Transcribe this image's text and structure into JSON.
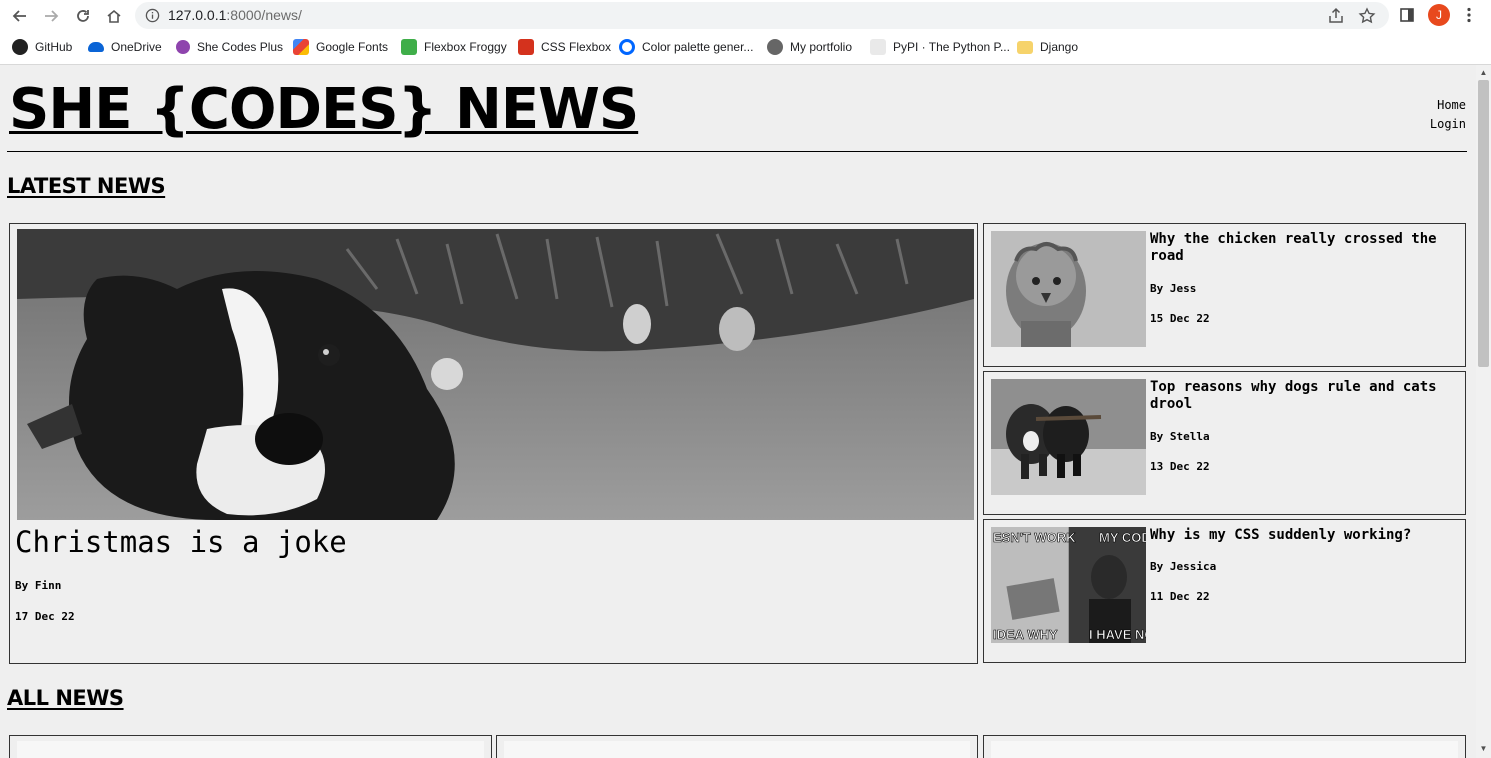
{
  "browser": {
    "url_host": "127.0.0.1",
    "url_rest": ":8000/news/",
    "profile_initial": "J",
    "bookmarks": [
      {
        "label": "GitHub",
        "icon": "github-icon"
      },
      {
        "label": "OneDrive",
        "icon": "onedrive-icon"
      },
      {
        "label": "She Codes Plus",
        "icon": "shecodes-icon"
      },
      {
        "label": "Google Fonts",
        "icon": "google-fonts-icon"
      },
      {
        "label": "Flexbox Froggy",
        "icon": "frog-icon"
      },
      {
        "label": "CSS Flexbox",
        "icon": "fb-icon"
      },
      {
        "label": "Color palette gener...",
        "icon": "coolors-icon"
      },
      {
        "label": "My portfolio",
        "icon": "globe-icon"
      },
      {
        "label": "PyPI · The Python P...",
        "icon": "pypi-icon"
      },
      {
        "label": "Django",
        "icon": "folder-icon"
      }
    ]
  },
  "site": {
    "title": "SHE {CODES} NEWS",
    "nav": [
      "Home",
      "Login"
    ]
  },
  "latest": {
    "heading": "LATEST NEWS",
    "feature": {
      "title": "Christmas is a joke",
      "author": "By Finn",
      "date": "17 Dec 22"
    },
    "side": [
      {
        "title": "Why the chicken really crossed the road",
        "author": "By Jess",
        "date": "15 Dec 22"
      },
      {
        "title": "Top reasons why dogs rule and cats drool",
        "author": "By Stella",
        "date": "13 Dec 22"
      },
      {
        "title": "Why is my CSS suddenly working?",
        "author": "By Jessica",
        "date": "11 Dec 22",
        "meme_text": [
          "ESN'T WORK",
          "MY CODE",
          "IDEA WHY",
          "I HAVE NO"
        ]
      }
    ]
  },
  "all": {
    "heading": "ALL NEWS"
  },
  "colors": {
    "page_bg": "#efefef",
    "avatar": "#e8491d",
    "text": "#000000"
  }
}
